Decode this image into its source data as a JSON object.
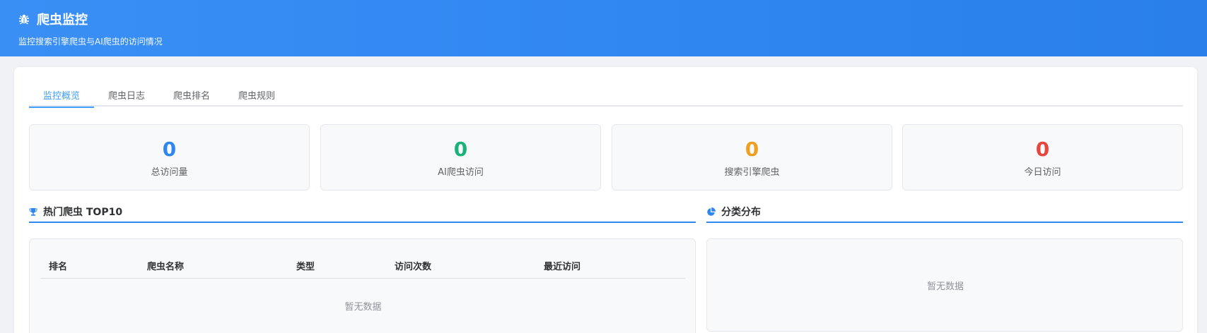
{
  "header": {
    "title": "爬虫监控",
    "subtitle": "监控搜索引擎爬虫与AI爬虫的访问情况"
  },
  "tabs": [
    {
      "label": "监控概览",
      "active": true
    },
    {
      "label": "爬虫日志",
      "active": false
    },
    {
      "label": "爬虫排名",
      "active": false
    },
    {
      "label": "爬虫规则",
      "active": false
    }
  ],
  "stats": [
    {
      "value": "0",
      "label": "总访问量",
      "color": "#2f86ef"
    },
    {
      "value": "0",
      "label": "AI爬虫访问",
      "color": "#19b37a"
    },
    {
      "value": "0",
      "label": "搜索引擎爬虫",
      "color": "#f0a020"
    },
    {
      "value": "0",
      "label": "今日访问",
      "color": "#e8453c"
    }
  ],
  "top10": {
    "title": "热门爬虫 TOP10",
    "columns": [
      "排名",
      "爬虫名称",
      "类型",
      "访问次数",
      "最近访问"
    ],
    "empty_text": "暂无数据"
  },
  "distribution": {
    "title": "分类分布",
    "empty_text": "暂无数据"
  },
  "colors": {
    "accent": "#2f86ef",
    "tab_active": "#409eff"
  }
}
